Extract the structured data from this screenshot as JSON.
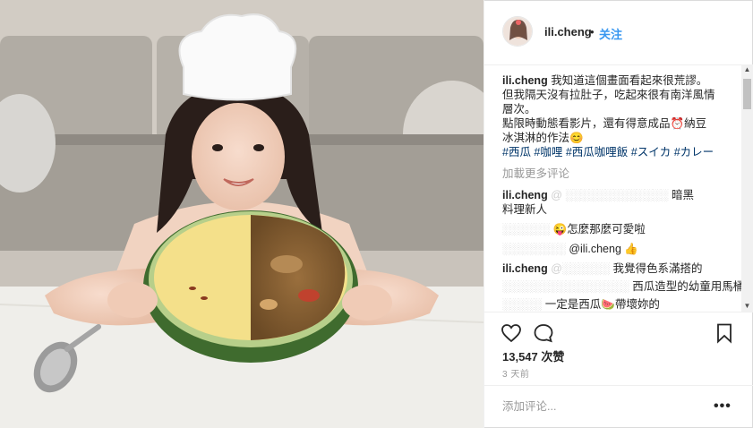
{
  "post": {
    "username": "ili.cheng",
    "separator": "•",
    "follow_label": "关注",
    "image_alt": "Girl in a chef hat holding a watermelon bowl filled with curry"
  },
  "caption": {
    "username": "ili.cheng",
    "line1": "我知道這個畫面看起來很荒謬。",
    "line2": "但我隔天沒有拉肚子，吃起來很有南洋風情",
    "line3": "層次。",
    "line4": "點限時動態看影片，還有得意成品⏰納豆",
    "line5": "冰淇淋的作法😊",
    "hashtags": "#西瓜 #咖哩 #西瓜咖哩飯 #スイカ #カレー"
  },
  "load_more": "加載更多评论",
  "comments": [
    {
      "username": "ili.cheng",
      "text_tail": "暗黑",
      "line2": "料理新人"
    },
    {
      "username": "",
      "text": "😜怎麼那麼可愛啦"
    },
    {
      "username": "",
      "text": "@ili.cheng 👍"
    },
    {
      "username": "ili.cheng",
      "text": "我覺得色系滿搭的",
      "line2": "西瓜造型的幼童用馬桶?"
    },
    {
      "username": "",
      "text": "一定是西瓜🍉帶壞妳的"
    }
  ],
  "likes": "13,547 次赞",
  "time_ago": "3 天前",
  "add_comment_placeholder": "添加评论...",
  "more_options": "•••",
  "icons": [
    "heart-icon",
    "comment-icon",
    "bookmark-icon",
    "more-options-icon"
  ],
  "colors": {
    "link": "#003569",
    "follow": "#3897f0",
    "muted": "#999999",
    "border": "#efefef"
  }
}
